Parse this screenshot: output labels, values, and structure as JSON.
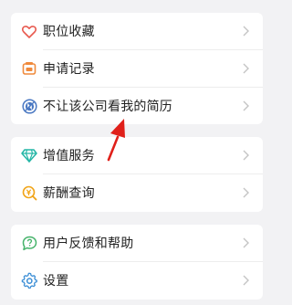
{
  "groups": [
    {
      "items": [
        {
          "icon": "heart-icon",
          "label": "职位收藏"
        },
        {
          "icon": "application-record-icon",
          "label": "申请记录"
        },
        {
          "icon": "block-company-icon",
          "label": "不让该公司看我的简历"
        }
      ]
    },
    {
      "items": [
        {
          "icon": "diamond-icon",
          "label": "增值服务"
        },
        {
          "icon": "salary-search-icon",
          "label": "薪酬查询"
        }
      ]
    },
    {
      "items": [
        {
          "icon": "feedback-help-icon",
          "label": "用户反馈和帮助"
        },
        {
          "icon": "settings-gear-icon",
          "label": "设置"
        }
      ]
    }
  ],
  "colors": {
    "heart": "#e85a4f",
    "record": "#f08a3c",
    "block": "#4a78c2",
    "diamond": "#24b6a6",
    "salary": "#f1a417",
    "feedback": "#45b36a",
    "settings": "#3d8fd6",
    "arrow": "#e0201a"
  }
}
